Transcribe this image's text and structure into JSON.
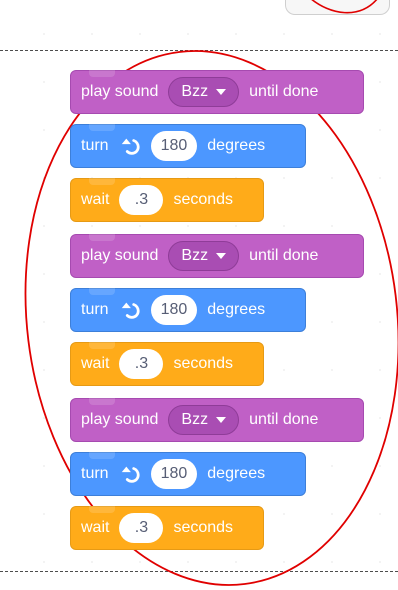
{
  "script": {
    "blocks": [
      {
        "type": "sound",
        "label": "play sound",
        "sound": "Bzz",
        "suffix": "until done"
      },
      {
        "type": "motion",
        "label": "turn",
        "value": "180",
        "suffix": "degrees"
      },
      {
        "type": "control",
        "label": "wait",
        "value": ".3",
        "suffix": "seconds"
      },
      {
        "type": "sound",
        "label": "play sound",
        "sound": "Bzz",
        "suffix": "until done"
      },
      {
        "type": "motion",
        "label": "turn",
        "value": "180",
        "suffix": "degrees"
      },
      {
        "type": "control",
        "label": "wait",
        "value": ".3",
        "suffix": "seconds"
      },
      {
        "type": "sound",
        "label": "play sound",
        "sound": "Bzz",
        "suffix": "until done"
      },
      {
        "type": "motion",
        "label": "turn",
        "value": "180",
        "suffix": "degrees"
      },
      {
        "type": "control",
        "label": "wait",
        "value": ".3",
        "suffix": "seconds"
      }
    ]
  },
  "colors": {
    "sound": "#c060c6",
    "motion": "#4c97ff",
    "control": "#ffab19",
    "annotation_ellipse": "#e00000"
  },
  "icons": {
    "turn": "turn-left-arrow-icon",
    "dropdown": "caret-down-icon"
  }
}
